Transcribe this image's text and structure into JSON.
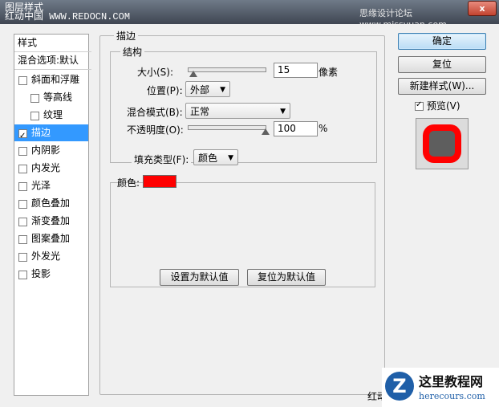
{
  "window": {
    "title": "图层样式",
    "watermark_left": "红动中国 WWW.REDOCN.COM",
    "watermark_right": "思缘设计论坛 www.missyuan.com",
    "close_label": "x"
  },
  "left_panel": {
    "header": "样式",
    "blend_options": "混合选项:默认",
    "items": [
      {
        "label": "斜面和浮雕",
        "checked": false
      },
      {
        "label": "等高线",
        "checked": false
      },
      {
        "label": "纹理",
        "checked": false
      },
      {
        "label": "描边",
        "checked": true,
        "selected": true
      },
      {
        "label": "内阴影",
        "checked": false
      },
      {
        "label": "内发光",
        "checked": false
      },
      {
        "label": "光泽",
        "checked": false
      },
      {
        "label": "颜色叠加",
        "checked": false
      },
      {
        "label": "渐变叠加",
        "checked": false
      },
      {
        "label": "图案叠加",
        "checked": false
      },
      {
        "label": "外发光",
        "checked": false
      },
      {
        "label": "投影",
        "checked": false
      }
    ]
  },
  "stroke": {
    "group_title": "描边",
    "structure_title": "结构",
    "size_label": "大小(S):",
    "size_value": "15",
    "size_unit": "像素",
    "position_label": "位置(P):",
    "position_value": "外部",
    "blend_mode_label": "混合模式(B):",
    "blend_mode_value": "正常",
    "opacity_label": "不透明度(O):",
    "opacity_value": "100",
    "opacity_unit": "%",
    "fill_type_label": "填充类型(F):",
    "fill_type_value": "颜色",
    "color_label": "颜色:",
    "color_hex": "#ff0000",
    "set_default_button": "设置为默认值",
    "reset_default_button": "复位为默认值"
  },
  "right_panel": {
    "ok_button": "确定",
    "reset_button": "复位",
    "new_style_button": "新建样式(W)...",
    "preview_label": "预览(V)",
    "preview_checked": true,
    "preview_fill_color": "#5e5e5e",
    "preview_stroke_color": "#ff0000"
  },
  "bottom_watermark": {
    "partial_text": "红动",
    "logo_letter": "Z",
    "title": "这里教程网",
    "url": "herecours.com"
  }
}
